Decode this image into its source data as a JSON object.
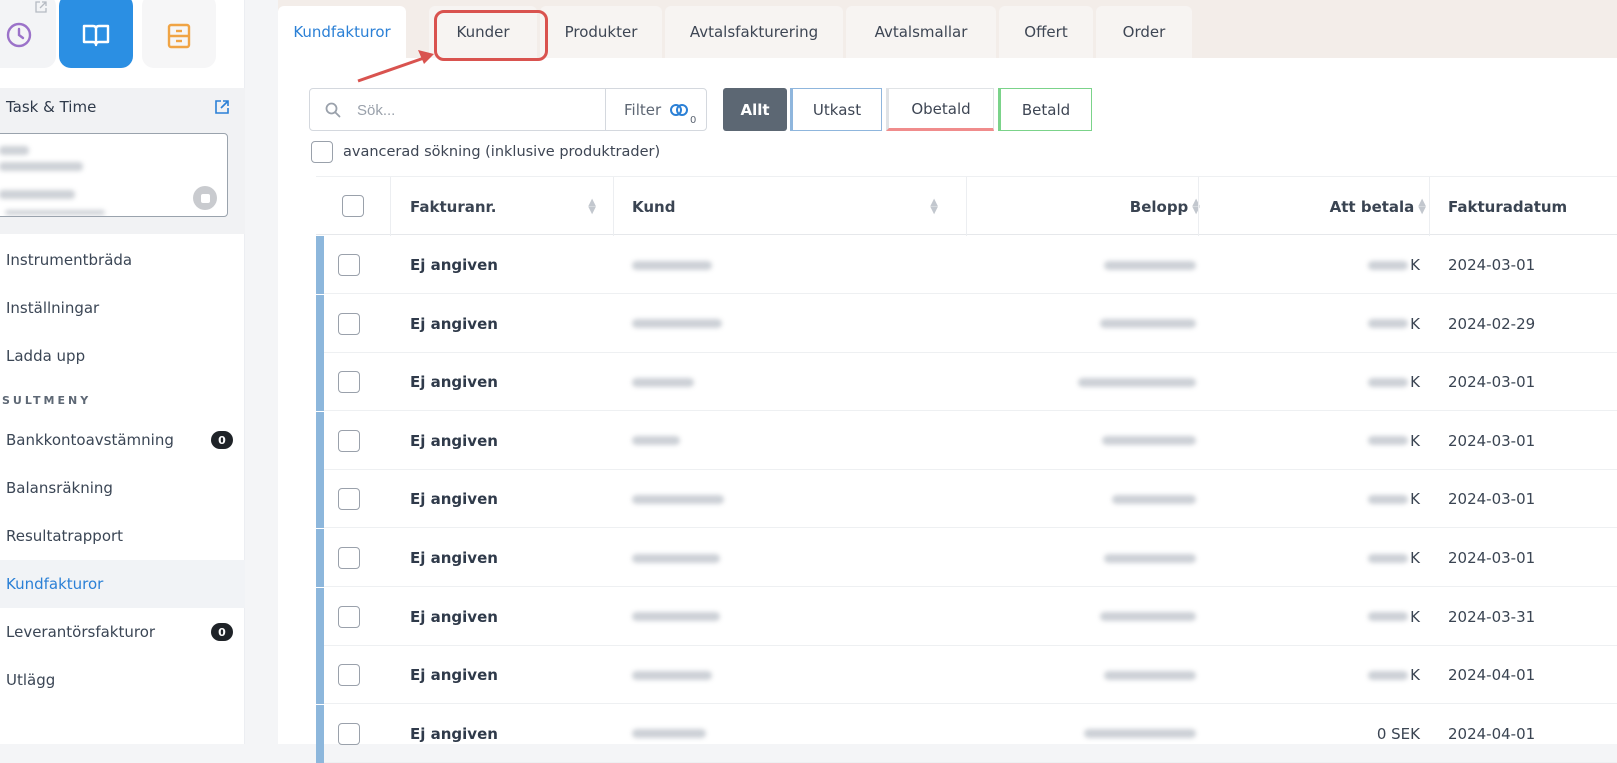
{
  "sidebar": {
    "task_title": "Task & Time",
    "nav": [
      {
        "label": "Instrumentbräda"
      },
      {
        "label": "Inställningar"
      },
      {
        "label": "Ladda upp"
      }
    ],
    "section_label": "SULTMENY",
    "nav2": [
      {
        "label": "Bankkontoavstämning",
        "badge": "0"
      },
      {
        "label": "Balansräkning"
      },
      {
        "label": "Resultatrapport"
      },
      {
        "label": "Kundfakturor",
        "active": true
      },
      {
        "label": "Leverantörsfakturor",
        "badge": "0"
      },
      {
        "label": "Utlägg"
      }
    ]
  },
  "tabs": [
    {
      "label": "Kundfakturor",
      "active": true
    },
    {
      "label": "Kunder"
    },
    {
      "label": "Produkter"
    },
    {
      "label": "Avtalsfakturering"
    },
    {
      "label": "Avtalsmallar"
    },
    {
      "label": "Offert"
    },
    {
      "label": "Order"
    }
  ],
  "toolbar": {
    "search_placeholder": "Sök...",
    "filter_label": "Filter",
    "filter_count": "0",
    "segments": {
      "all": "Allt",
      "draft": "Utkast",
      "unpaid": "Obetald",
      "paid": "Betald"
    },
    "advanced_search": "avancerad sökning (inklusive produktrader)"
  },
  "table": {
    "headers": {
      "number": "Fakturanr.",
      "customer": "Kund",
      "amount": "Belopp",
      "to_pay": "Att betala",
      "date": "Fakturadatum"
    },
    "rows": [
      {
        "number": "Ej angiven",
        "to_pay_suffix": "K",
        "date": "2024-03-01"
      },
      {
        "number": "Ej angiven",
        "to_pay_suffix": "K",
        "date": "2024-02-29"
      },
      {
        "number": "Ej angiven",
        "to_pay_suffix": "K",
        "date": "2024-03-01"
      },
      {
        "number": "Ej angiven",
        "to_pay_suffix": "K",
        "date": "2024-03-01"
      },
      {
        "number": "Ej angiven",
        "to_pay_suffix": "K",
        "date": "2024-03-01"
      },
      {
        "number": "Ej angiven",
        "to_pay_suffix": "K",
        "date": "2024-03-01"
      },
      {
        "number": "Ej angiven",
        "to_pay_suffix": "K",
        "date": "2024-03-31"
      },
      {
        "number": "Ej angiven",
        "to_pay_suffix": "K",
        "date": "2024-04-01"
      },
      {
        "number": "Ej angiven",
        "to_pay_suffix": "0 SEK",
        "date": "2024-04-01"
      }
    ]
  },
  "colors": {
    "accent": "#2b80d6",
    "primary_tile": "#2b8fe3",
    "highlight": "#d9534f",
    "row_accent": "#8db7dc"
  }
}
